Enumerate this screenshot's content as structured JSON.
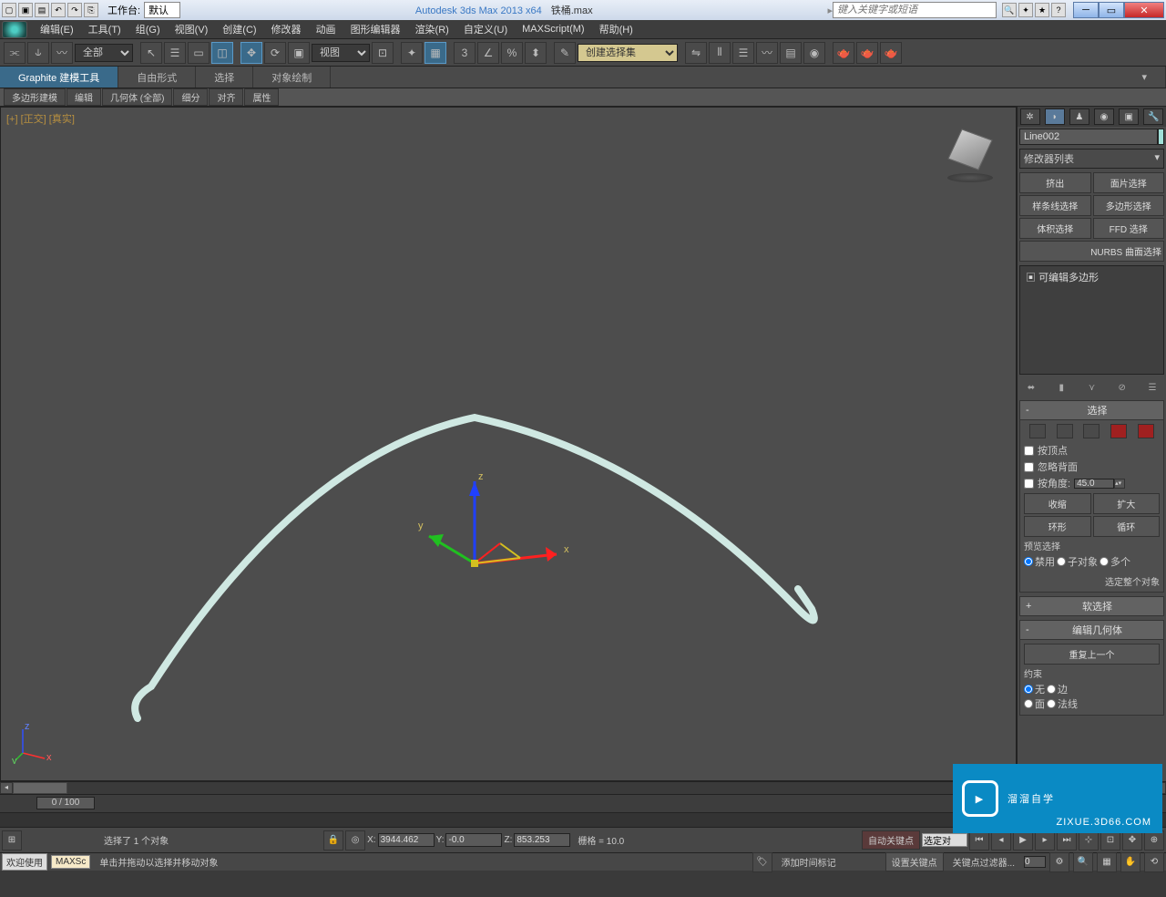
{
  "titlebar": {
    "workspace_label": "工作台:",
    "workspace_value": "默认",
    "app": "Autodesk 3ds Max  2013 x64",
    "file": "铁桶.max",
    "search_placeholder": "键入关键字或短语"
  },
  "menu": [
    "编辑(E)",
    "工具(T)",
    "组(G)",
    "视图(V)",
    "创建(C)",
    "修改器",
    "动画",
    "图形编辑器",
    "渲染(R)",
    "自定义(U)",
    "MAXScript(M)",
    "帮助(H)"
  ],
  "toolbar": {
    "filter": "全部",
    "view": "视图",
    "named_sel": "创建选择集"
  },
  "ribbon": {
    "tabs": [
      "Graphite 建模工具",
      "自由形式",
      "选择",
      "对象绘制"
    ],
    "sub": [
      "多边形建模",
      "编辑",
      "几何体 (全部)",
      "细分",
      "对齐",
      "属性"
    ]
  },
  "viewport": {
    "label": "[+] [正交] [真实]",
    "axes": {
      "x": "x",
      "y": "y",
      "z": "z"
    }
  },
  "panel": {
    "object": "Line002",
    "modlist": "修改器列表",
    "btns": [
      "挤出",
      "面片选择",
      "样条线选择",
      "多边形选择",
      "体积选择",
      "FFD 选择"
    ],
    "nurbs": "NURBS 曲面选择",
    "stack_item": "可编辑多边形",
    "sel": {
      "title": "选择",
      "byvertex": "按顶点",
      "ignoreback": "忽略背面",
      "byangle": "按角度:",
      "angle": "45.0",
      "shrink": "收缩",
      "grow": "扩大",
      "ring": "环形",
      "loop": "循环",
      "preview": "预览选择",
      "radios": [
        "禁用",
        "子对象",
        "多个"
      ],
      "selwhole": "选定整个对象"
    },
    "soft": {
      "title": "软选择"
    },
    "geom": {
      "title": "编辑几何体",
      "repeat": "重复上一个",
      "constraint": "约束",
      "r": [
        "无",
        "边",
        "面",
        "法线"
      ]
    }
  },
  "timeline": {
    "pos": "0 / 100"
  },
  "status": {
    "sel": "选择了 1 个对象",
    "hint": "单击并拖动以选择并移动对象",
    "x": "3944.462",
    "y": "-0.0",
    "z": "853.253",
    "grid": "栅格 = 10.0",
    "autokey": "自动关键点",
    "setkey": "设置关键点",
    "selset": "选定对",
    "keyfilter": "关键点过滤器...",
    "addmarker": "添加时间标记",
    "welcome": "欢迎使用",
    "maxsc": "MAXSc"
  },
  "coords": {
    "xl": "X:",
    "yl": "Y:",
    "zl": "Z:"
  },
  "watermark": {
    "brand": "溜溜自学",
    "url": "ZIXUE.3D66.COM"
  },
  "framenum": "0"
}
